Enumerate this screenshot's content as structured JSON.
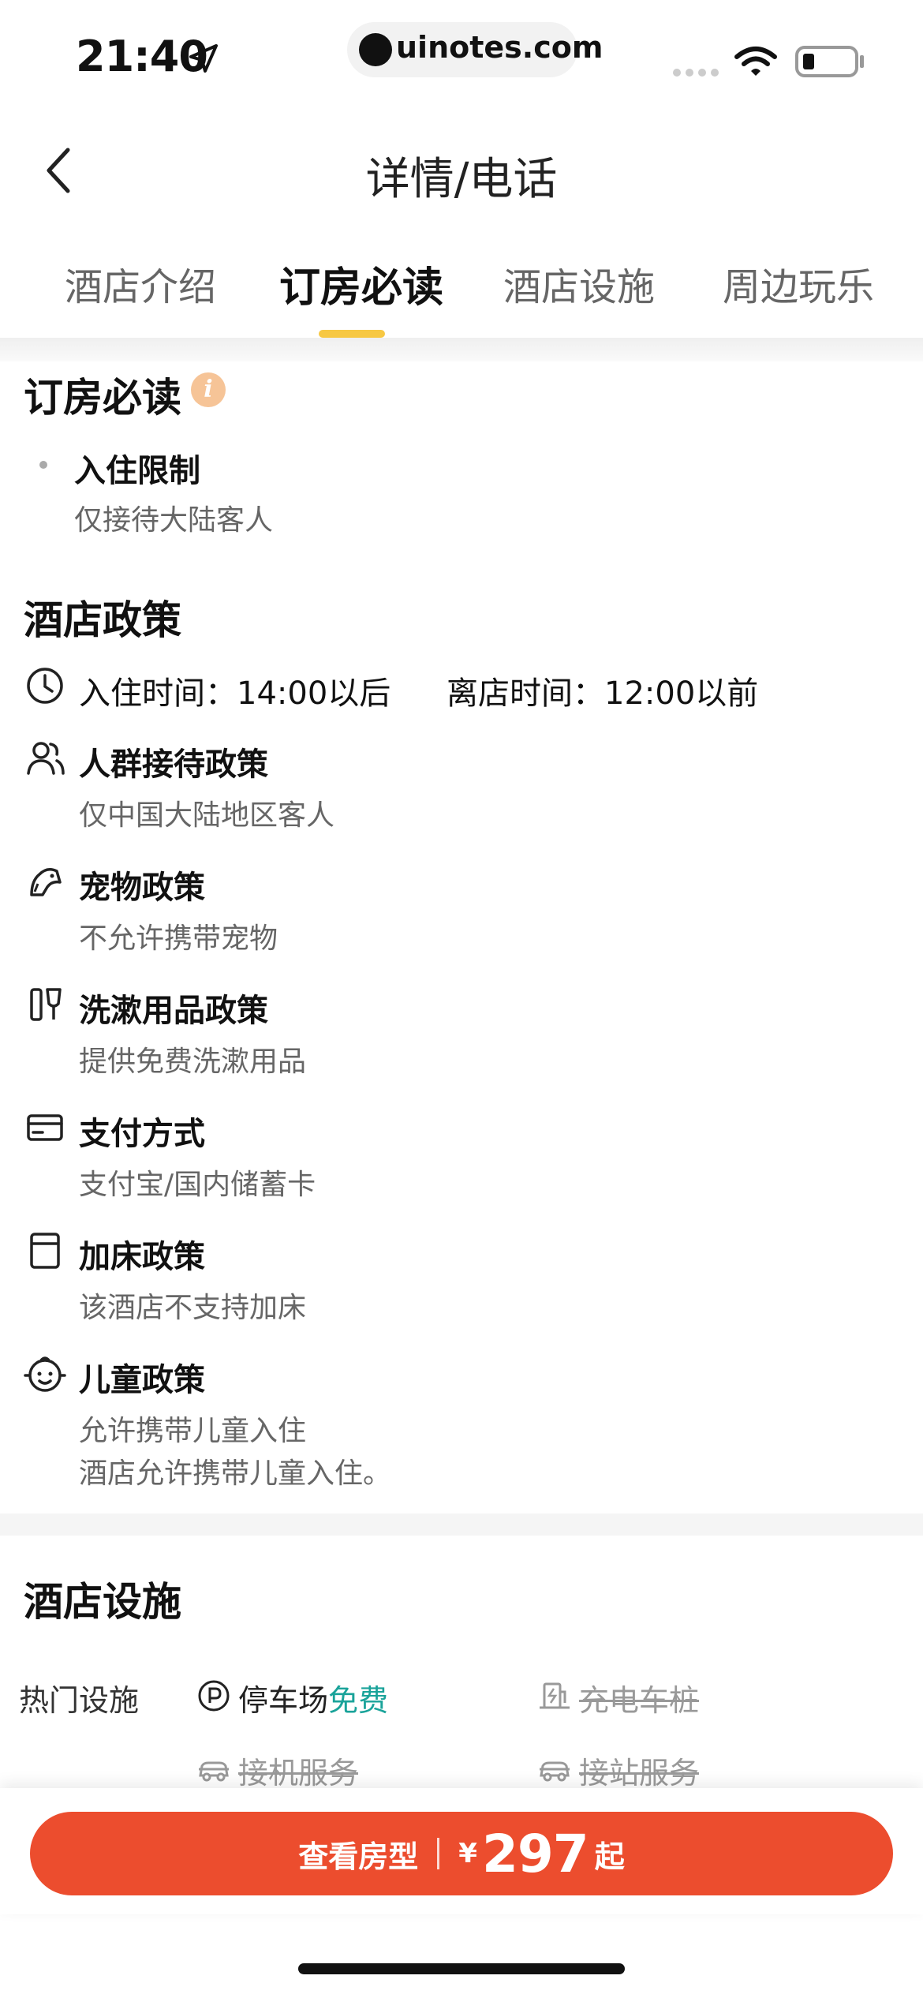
{
  "status_bar": {
    "time": "21:40",
    "url": "uinotes.com"
  },
  "nav": {
    "title": "详情/电话"
  },
  "tabs": [
    {
      "label": "酒店介绍"
    },
    {
      "label": "订房必读"
    },
    {
      "label": "酒店设施"
    },
    {
      "label": "周边玩乐"
    }
  ],
  "booking_notice": {
    "title": "订房必读",
    "info_glyph": "i",
    "item_title": "入住限制",
    "item_desc": "仅接待大陆客人"
  },
  "policy": {
    "title": "酒店政策",
    "checkin": "入住时间：14:00以后",
    "checkout": "离店时间：12:00以前",
    "items": [
      {
        "icon": "people-icon",
        "title": "人群接待政策",
        "desc": "仅中国大陆地区客人"
      },
      {
        "icon": "pet-icon",
        "title": "宠物政策",
        "desc": "不允许携带宠物"
      },
      {
        "icon": "toiletries-icon",
        "title": "洗漱用品政策",
        "desc": "提供免费洗漱用品"
      },
      {
        "icon": "card-icon",
        "title": "支付方式",
        "desc": "支付宝/国内储蓄卡"
      },
      {
        "icon": "bed-icon",
        "title": "加床政策",
        "desc": "该酒店不支持加床"
      },
      {
        "icon": "child-icon",
        "title": "儿童政策",
        "desc": "允许携带儿童入住",
        "desc2": "酒店允许携带儿童入住。"
      }
    ]
  },
  "facilities": {
    "title": "酒店设施",
    "hot_label": "热门设施",
    "parking": "停车场",
    "parking_free": "免费",
    "charging": "充电车桩",
    "airport": "接机服务",
    "station": "接站服务"
  },
  "cta": {
    "label": "查看房型",
    "currency": "¥",
    "price": "297",
    "suffix": "起"
  },
  "colors": {
    "accent": "#ec4d2e",
    "tab_underline": "#f7c843",
    "free_green": "#1aa39a"
  }
}
